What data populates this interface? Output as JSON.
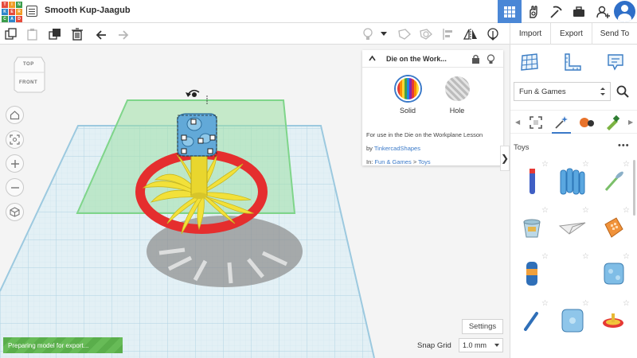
{
  "app": {
    "logo_letters": [
      "T",
      "I",
      "N",
      "K",
      "E",
      "R",
      "C",
      "A",
      "D"
    ],
    "logo_colors": [
      "#e64b3c",
      "#f29b26",
      "#3b9d4c",
      "#2f86c9",
      "#e64b3c",
      "#f29b26",
      "#3b9d4c",
      "#2f86c9",
      "#e64b3c"
    ],
    "design_title": "Smooth Kup-Jaagub",
    "accent": "#4a87d6"
  },
  "topbar": {
    "icons": [
      "grid-view-icon",
      "gallery-hand-icon",
      "pickaxe-icon",
      "toolbox-icon",
      "add-user-icon",
      "avatar"
    ]
  },
  "toolbar": {
    "tools": [
      "copy",
      "paste",
      "duplicate",
      "delete",
      "undo",
      "redo"
    ],
    "view_tools": [
      "bulb",
      "bulb-caret",
      "group",
      "ungroup",
      "align",
      "mirror",
      "cruise"
    ],
    "import_label": "Import",
    "export_label": "Export",
    "send_to_label": "Send To"
  },
  "viewcube": {
    "top_label": "TOP",
    "front_label": "FRONT"
  },
  "nav_controls": [
    "home",
    "fit",
    "zoom-in",
    "zoom-out",
    "perspective"
  ],
  "props": {
    "title": "Die on the Work...",
    "solid_label": "Solid",
    "hole_label": "Hole",
    "description": "For use in the Die on the Workplane Lesson",
    "by_prefix": "by",
    "author": "TinkercadShapes",
    "in_prefix": "In:",
    "category": "Fun & Games",
    "separator": ">",
    "subcategory": "Toys"
  },
  "workplane": {
    "settings_label": "Settings",
    "snap_grid_label": "Snap Grid",
    "snap_grid_value": "1.0 mm",
    "toast": "Preparing model for export..."
  },
  "panel": {
    "category_select": "Fun & Games",
    "section_title": "Toys",
    "more": "•••",
    "shapes": [
      "blue-pencil",
      "blue-crayon-pack",
      "propeller-stick",
      "sand-bucket",
      "paper-plane",
      "orange-calculator",
      "soda-can",
      "blank",
      "blue-die",
      "blue-stick",
      "blue-die-2",
      "red-spinning-top"
    ]
  }
}
